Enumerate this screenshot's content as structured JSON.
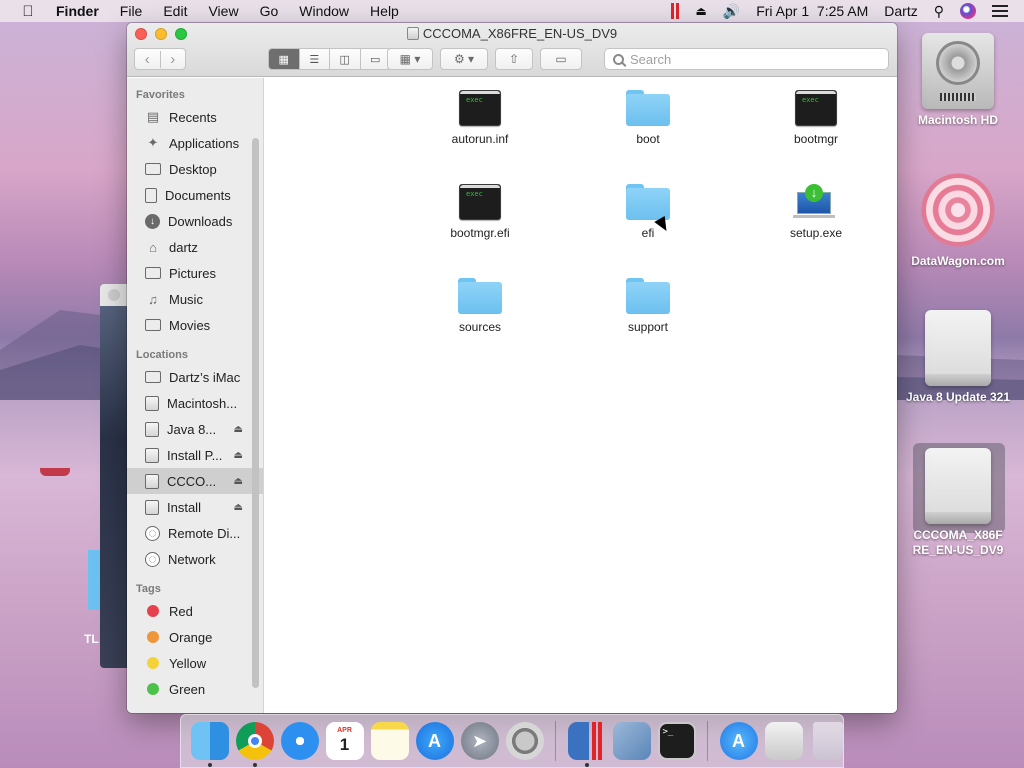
{
  "menubar": {
    "app_name": "Finder",
    "menus": [
      "File",
      "Edit",
      "View",
      "Go",
      "Window",
      "Help"
    ],
    "clock": "Fri Apr 1  7:25 AM",
    "user": "Dartz"
  },
  "window": {
    "title": "CCCOMA_X86FRE_EN-US_DV9",
    "search_placeholder": "Search"
  },
  "sidebar": {
    "favorites_heading": "Favorites",
    "favorites": [
      {
        "label": "Recents",
        "icon": "recents-icon"
      },
      {
        "label": "Applications",
        "icon": "applications-icon"
      },
      {
        "label": "Desktop",
        "icon": "desktop-icon"
      },
      {
        "label": "Documents",
        "icon": "documents-icon"
      },
      {
        "label": "Downloads",
        "icon": "downloads-icon"
      },
      {
        "label": "dartz",
        "icon": "home-icon"
      },
      {
        "label": "Pictures",
        "icon": "pictures-icon"
      },
      {
        "label": "Music",
        "icon": "music-icon"
      },
      {
        "label": "Movies",
        "icon": "movies-icon"
      }
    ],
    "locations_heading": "Locations",
    "locations": [
      {
        "label": "Dartz’s iMac",
        "icon": "computer-icon",
        "eject": false
      },
      {
        "label": "Macintosh...",
        "icon": "disk-icon",
        "eject": false
      },
      {
        "label": "Java 8...",
        "icon": "disk-icon",
        "eject": true
      },
      {
        "label": "Install P...",
        "icon": "disk-icon",
        "eject": true
      },
      {
        "label": "CCCO...",
        "icon": "disk-icon",
        "eject": true,
        "selected": true
      },
      {
        "label": "Install",
        "icon": "disk-icon",
        "eject": true
      },
      {
        "label": "Remote Di...",
        "icon": "remote-disc-icon",
        "eject": false
      },
      {
        "label": "Network",
        "icon": "network-icon",
        "eject": false
      }
    ],
    "tags_heading": "Tags",
    "tags": [
      {
        "label": "Red",
        "color": "#e5424e"
      },
      {
        "label": "Orange",
        "color": "#f0963a"
      },
      {
        "label": "Yellow",
        "color": "#f4d23a"
      },
      {
        "label": "Green",
        "color": "#4cc24a"
      }
    ]
  },
  "files": [
    {
      "name": "autorun.inf",
      "kind": "exec"
    },
    {
      "name": "boot",
      "kind": "folder"
    },
    {
      "name": "bootmgr",
      "kind": "exec"
    },
    {
      "name": "bootmgr.efi",
      "kind": "exec"
    },
    {
      "name": "efi",
      "kind": "folder"
    },
    {
      "name": "setup.exe",
      "kind": "setup"
    },
    {
      "name": "sources",
      "kind": "folder"
    },
    {
      "name": "support",
      "kind": "folder"
    }
  ],
  "exec_badge": "exec",
  "desktop": {
    "icons": [
      {
        "label": "Macintosh HD"
      },
      {
        "label": "DataWagon.com"
      },
      {
        "label": "Java 8 Update 321"
      },
      {
        "label": "CCCOMA_X86FRE_EN-US_DV9"
      }
    ],
    "partial_label": "TL"
  },
  "dock": {
    "calendar_month": "APR",
    "calendar_day": "1",
    "terminal_prompt": ">_"
  }
}
